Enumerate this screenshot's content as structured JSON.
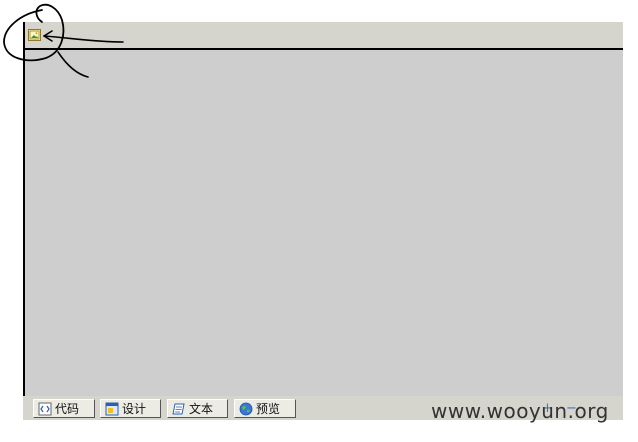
{
  "editor": {
    "toolbar": {
      "image_button_icon": "image-icon"
    },
    "mode_tabs": [
      {
        "label": "代码",
        "icon": "code-icon"
      },
      {
        "label": "设计",
        "icon": "design-icon"
      },
      {
        "label": "文本",
        "icon": "text-icon"
      },
      {
        "label": "预览",
        "icon": "globe-icon"
      }
    ],
    "zoom": {
      "in_glyph": "+",
      "out_glyph": "−"
    }
  },
  "watermark": "www.wooyun.org",
  "colors": {
    "toolbar": "#d6d5cd",
    "canvas": "#cecece",
    "annotation": "#000000"
  }
}
